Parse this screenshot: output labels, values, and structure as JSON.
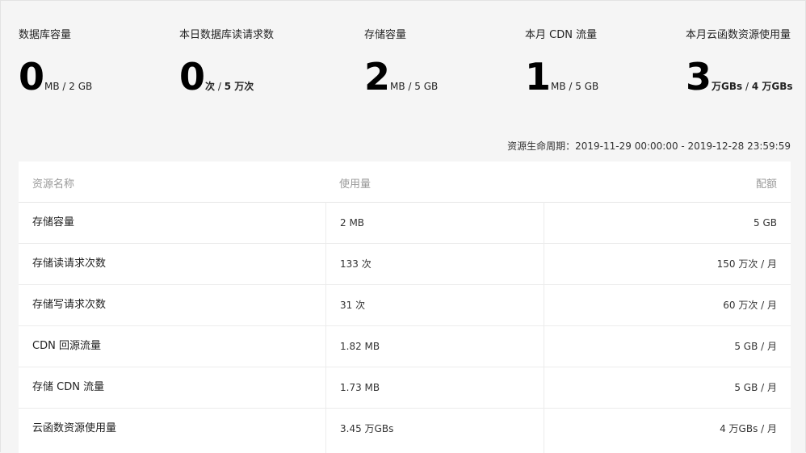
{
  "stats": [
    {
      "label": "数据库容量",
      "value": "0",
      "unit_used": "MB",
      "sep": " / ",
      "unit_total": "2 GB"
    },
    {
      "label": "本日数据库读请求数",
      "value": "0",
      "unit_used": "次",
      "sep": " / ",
      "unit_total": "5 万次"
    },
    {
      "label": "存储容量",
      "value": "2",
      "unit_used": "MB",
      "sep": " / ",
      "unit_total": "5 GB"
    },
    {
      "label": "本月 CDN 流量",
      "value": "1",
      "unit_used": "MB",
      "sep": " / ",
      "unit_total": "5 GB"
    },
    {
      "label": "本月云函数资源使用量",
      "value": "3",
      "unit_used": "万GBs",
      "sep": " / ",
      "unit_total": "4 万GBs"
    }
  ],
  "lifecycle": "资源生命周期：2019-11-29 00:00:00 - 2019-12-28 23:59:59",
  "table": {
    "headers": {
      "name": "资源名称",
      "usage": "使用量",
      "quota": "配额"
    },
    "rows": [
      {
        "name": "存储容量",
        "usage": "2 MB",
        "quota": "5 GB"
      },
      {
        "name": "存储读请求次数",
        "usage": "133 次",
        "quota": "150 万次 / 月"
      },
      {
        "name": "存储写请求次数",
        "usage": "31 次",
        "quota": "60 万次 / 月"
      },
      {
        "name": "CDN 回源流量",
        "usage": "1.82 MB",
        "quota": "5 GB / 月"
      },
      {
        "name": "存储 CDN 流量",
        "usage": "1.73 MB",
        "quota": "5 GB / 月"
      },
      {
        "name": "云函数资源使用量",
        "usage": "3.45 万GBs",
        "quota": "4 万GBs / 月"
      }
    ]
  }
}
